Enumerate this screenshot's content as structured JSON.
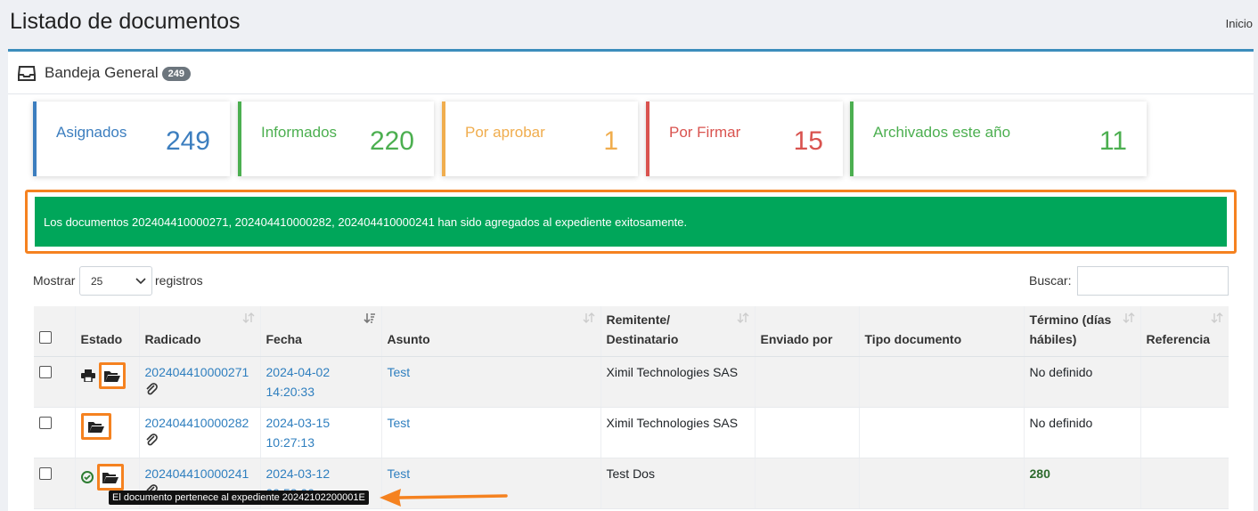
{
  "page": {
    "title": "Listado de documentos",
    "breadcrumb": "Inicio"
  },
  "panel": {
    "title": "Bandeja General",
    "badge": "249"
  },
  "stats": [
    {
      "label": "Asignados",
      "value": "249",
      "color": "#3c7ebf"
    },
    {
      "label": "Informados",
      "value": "220",
      "color": "#4caf50"
    },
    {
      "label": "Por aprobar",
      "value": "1",
      "color": "#f0ad4e"
    },
    {
      "label": "Por Firmar",
      "value": "15",
      "color": "#d9534f"
    },
    {
      "label": "Archivados este año",
      "value": "11",
      "color": "#4caf50"
    }
  ],
  "alert": {
    "message": "Los documentos 202404410000271, 202404410000282, 202404410000241 han sido agregados al expediente exitosamente."
  },
  "length_control": {
    "prefix": "Mostrar",
    "value": "25",
    "suffix": "registros"
  },
  "search": {
    "label": "Buscar:",
    "value": ""
  },
  "table": {
    "headers": {
      "estado": "Estado",
      "radicado": "Radicado",
      "fecha": "Fecha",
      "asunto": "Asunto",
      "remitente_1": "Remitente/",
      "remitente_2": "Destinatario",
      "enviado": "Enviado por",
      "tipo": "Tipo documento",
      "termino_1": "Término (días",
      "termino_2": "hábiles)",
      "referencia": "Referencia"
    },
    "rows": [
      {
        "radicado": "202404410000271",
        "fecha_date": "2024-04-02",
        "fecha_time": "14:20:33",
        "asunto": "Test",
        "remitente": "Ximil Technologies SAS",
        "enviado": "",
        "tipo": "",
        "termino": "No definido",
        "referencia": ""
      },
      {
        "radicado": "202404410000282",
        "fecha_date": "2024-03-15",
        "fecha_time": "10:27:13",
        "asunto": "Test",
        "remitente": "Ximil Technologies SAS",
        "enviado": "",
        "tipo": "",
        "termino": "No definido",
        "referencia": ""
      },
      {
        "radicado": "202404410000241",
        "fecha_date": "2024-03-12",
        "fecha_time": "09:53:00",
        "asunto": "Test",
        "remitente": "Test Dos",
        "enviado": "",
        "tipo": "",
        "termino": "280",
        "referencia": ""
      }
    ]
  },
  "tooltip": {
    "text": "El documento pertenece al expediente 20242102200001E"
  },
  "colors": {
    "accent": "#3c8dbc",
    "success": "#00a65a",
    "highlight": "#f58220"
  },
  "icons": [
    "inbox-icon",
    "printer-icon",
    "folder-open-icon",
    "paperclip-icon",
    "check-circle-icon",
    "sort-icon",
    "chevron-down-icon",
    "arrow-left-icon"
  ]
}
